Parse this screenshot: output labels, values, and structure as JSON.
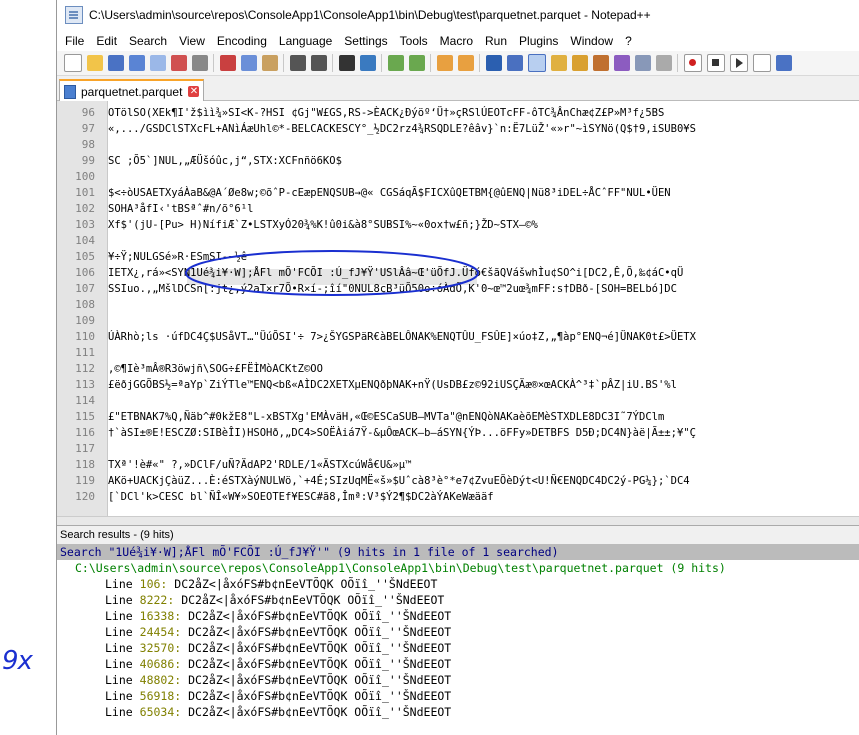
{
  "annotation": "9x",
  "window": {
    "title": "C:\\Users\\admin\\source\\repos\\ConsoleApp1\\ConsoleApp1\\bin\\Debug\\test\\parquetnet.parquet - Notepad++"
  },
  "menu": [
    "File",
    "Edit",
    "Search",
    "View",
    "Encoding",
    "Language",
    "Settings",
    "Tools",
    "Macro",
    "Run",
    "Plugins",
    "Window",
    "?"
  ],
  "tab": {
    "label": "parquetnet.parquet"
  },
  "editor": {
    "lines": [
      {
        "num": "96",
        "text": "OTölSO(XEk¶I'ž$ìì¾»SI<K-?HSI ¢Gj\"W£GS,RS->ÈACK¿Ðýöº‘Ü†»çRSlÚEOTcFF-ôTC¾ÂnChæ¢Z£P»M³f¿5BS"
      },
      {
        "num": "97",
        "text": "«,.../GSDClSTXcFL+ANìÁæUhl©*-BELCACKESCY°_½DC2rz4¾RSQDLE?êâv}`n:Ë7LüŽ'«»r\"~ìSYNö(Q$†9,iSUB0¥S"
      },
      {
        "num": "98",
        "text": ""
      },
      {
        "num": "99",
        "text": "SC ;Õ5`]NUL,„ÆÜšóûc,j“,STX:XCFnñö6KO$"
      },
      {
        "num": "100",
        "text": ""
      },
      {
        "num": "101",
        "text": "$<÷òUSAETXyáÀaB&@A´Øe8w;©õˆP-cEæpENQSUB→@« CGSáqÃ$FICXûQETBM{@ûENQ|Nü8³iDEL÷ÅCˆFF\"NUL•ÜEN"
      },
      {
        "num": "102",
        "text": "SOHA³åfI‹'tBSªˆ#n/õ°6¹l"
      },
      {
        "num": "103",
        "text": "Xf$'(jU-[Pu> H)NífiÆ`Z•LSTXyÓ20¾%K!û0i&à8°SUBSI%~«0ox†w£ñ;}ŽD~STX—©%"
      },
      {
        "num": "104",
        "text": ""
      },
      {
        "num": "105",
        "text": "¥÷Ÿ;NULGSé»R·ESmSI-~½ê"
      },
      {
        "num": "106",
        "text": "IETX¿,rá»<SYN1Ué¾i¥·W];ÅFl mÕ'FCÕI :Ú_fJ¥Ÿ'USlÂâ~Œ'üÕfJ.Üfó€šãQVášwhÌu¢SO^i[DC2,Ê,Õ,‰¢áC•qÜ"
      },
      {
        "num": "107",
        "text": "SSIuo.,„MšlDCSn[:jt¿,ý2aT×r7Õ•R×í-;îí\"0NUL8çB³üÕ50o÷óÀdÕ,K'0~œ™2uœ¾mFF:s†DBð-[SOH=BELbó]DC"
      },
      {
        "num": "108",
        "text": ""
      },
      {
        "num": "109",
        "text": ""
      },
      {
        "num": "110",
        "text": "ÚÀRhò;ls ·úfDC4Ç$USåVT…\"ÜúÕSI'÷ 7>¿ŠYGSPäR€àBELÔNAK%ENQTÛU_FSÛE]×úo‡Z,„¶àp°ENQ¬é]ÜNAK0t£>ÜETX"
      },
      {
        "num": "111",
        "text": ""
      },
      {
        "num": "112",
        "text": ",©¶Iè³mÂ®R3öwjñ\\SOG÷£FËÌMòACKtZ©OO"
      },
      {
        "num": "113",
        "text": "£ëðjGGÕBS½=ªaYp`ZiÝTle™ENQ<bß«AÌDC2XETXµENQðþNAK+nŸ(UsDB£z©92iUSÇÄæ®×œACKÀ^³‡`pÂZ|iU.BS'%l"
      },
      {
        "num": "114",
        "text": ""
      },
      {
        "num": "115",
        "text": "£\"ETBNAK7%Q,Ñäb^#0kžE8\"L-xBSTXg'EMÀväH,«Œ©ESCaSUB—MVTa\"@nENQòNAKaèõEMèSTXDLE8DC3I˜7ÝDClm"
      },
      {
        "num": "116",
        "text": "†`àSI±®E!ESCZØ:SIBèÎI)HSOHð,„DC4>SOËÀiá7Ÿ-&µÔœACK—b—áSYN{ÝÞ...öFFy»DETBFS D5Ð;DC4N}àë|Ã±±;¥\"Ç"
      },
      {
        "num": "117",
        "text": ""
      },
      {
        "num": "118",
        "text": "TXª'!è#«\" ?,»DClF/uÑ?ÄdAP2'RDLE/1«ÄSTXcúWå€U&»µ™"
      },
      {
        "num": "119",
        "text": "AKö+UACKjÇàüZ...È:éSTXàýNULWö,`+4É;SIzUqMË«š»$Uˆcà8³è°*e7¢ZvuEÕèDýt<U!Ñ€ENQDC4DC2ý-PG¼};`DC4"
      },
      {
        "num": "120",
        "text": "[`DCl'k>CESC bl`ÑÎ«W¥»SOEOTEf¥ESC#ã8,Îmª:V³$Ý2¶$DC2àÝAKeWæääf"
      }
    ]
  },
  "search_panel": {
    "title": "Search results - (9 hits)",
    "summary": "Search \"1Ué¾i¥·W];ÅFl mÕ'FCÕI :Ú_fJ¥Ÿ'\" (9 hits in 1 file of 1 searched)",
    "file": "C:\\Users\\admin\\source\\repos\\ConsoleApp1\\ConsoleApp1\\bin\\Debug\\test\\parquetnet.parquet (9 hits)",
    "hits": [
      {
        "label": "Line",
        "num": "106:",
        "text": "DC2åZ<|åxóFS#b¢nEeVTÕQK  OÕïî_''ŠNdEEOT"
      },
      {
        "label": "Line",
        "num": "8222:",
        "text": "DC2åZ<|åxóFS#b¢nEeVTÕQK  OÕïî_''ŠNdEEOT"
      },
      {
        "label": "Line",
        "num": "16338:",
        "text": "DC2åZ<|åxóFS#b¢nEeVTÕQK   OÕïî_''ŠNdEEOT"
      },
      {
        "label": "Line",
        "num": "24454:",
        "text": "DC2åZ<|åxóFS#b¢nEeVTÕQK   OÕïî_''ŠNdEEOT"
      },
      {
        "label": "Line",
        "num": "32570:",
        "text": "DC2åZ<|åxóFS#b¢nEeVTÕQK   OÕïî_''ŠNdEEOT"
      },
      {
        "label": "Line",
        "num": "40686:",
        "text": "DC2åZ<|åxóFS#b¢nEeVTÕQK   OÕïî_''ŠNdEEOT"
      },
      {
        "label": "Line",
        "num": "48802:",
        "text": "DC2åZ<|åxóFS#b¢nEeVTÕQK   OÕïî_''ŠNdEEOT"
      },
      {
        "label": "Line",
        "num": "56918:",
        "text": "DC2åZ<|åxóFS#b¢nEeVTÕQK   OÕïî_''ŠNdEEOT"
      },
      {
        "label": "Line",
        "num": "65034:",
        "text": "DC2åZ<|åxóFS#b¢nEeVTÕQK   OÕïî_''ŠNdEEOT"
      }
    ]
  },
  "colors": {
    "tab_accent": "#f9a429",
    "annotation_ink": "#1a2fd0",
    "search_header_text": "#000080",
    "file_path_text": "#008000",
    "line_number_text": "#808000"
  },
  "toolbar_icons": [
    "new-file-icon",
    "open-file-icon",
    "save-icon",
    "save-all-icon",
    "close-icon",
    "close-all-icon",
    "print-icon",
    "cut-icon",
    "copy-icon",
    "paste-icon",
    "undo-icon",
    "redo-icon",
    "find-icon",
    "replace-icon",
    "zoom-in-icon",
    "zoom-out-icon",
    "sync-v-icon",
    "sync-h-icon",
    "word-wrap-icon",
    "show-all-chars-icon",
    "indent-guide-icon",
    "udl-icon",
    "doc-map-icon",
    "function-list-icon",
    "folder-workspace-icon",
    "monitor-icon",
    "record-macro-icon",
    "stop-macro-icon",
    "play-macro-icon",
    "play-multi-icon",
    "save-macro-icon"
  ]
}
